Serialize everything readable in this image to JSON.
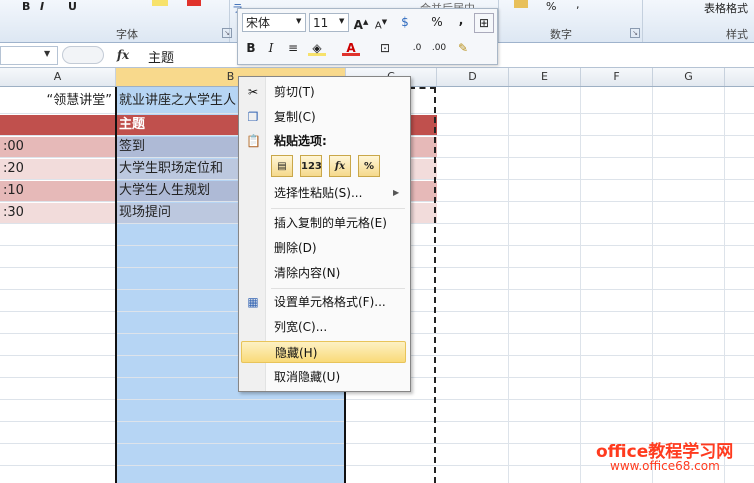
{
  "ribbon": {
    "font_group_label": "字体",
    "number_group_label": "数字",
    "styles_group_label": "样式",
    "table_format_label": "表格格式",
    "merge_center_label": "合并后居中",
    "percent_label": "%",
    "comma_label": ","
  },
  "formula_bar": {
    "fx_label": "fx",
    "content": "主题"
  },
  "columns": [
    "A",
    "B",
    "C",
    "D",
    "E",
    "F",
    "G"
  ],
  "sheet": {
    "title_row_a": "“领慧讲堂”",
    "title_row_b": "就业讲座之大学生人",
    "header_b": "主题",
    "rows": [
      {
        "a": ":00",
        "b": "签到"
      },
      {
        "a": ":20",
        "b": "大学生职场定位和"
      },
      {
        "a": ":10",
        "b": "大学生人生规划"
      },
      {
        "a": ":30",
        "b": "现场提问"
      }
    ]
  },
  "mini_toolbar": {
    "font_name": "宋体",
    "font_size": "11",
    "bold": "B",
    "italic": "I",
    "percent": "%",
    "comma": ","
  },
  "context_menu": {
    "cut": "剪切(T)",
    "copy": "复制(C)",
    "paste_options": "粘贴选项:",
    "paste_buttons": [
      "",
      "123",
      "fx",
      "%"
    ],
    "paste_special": "选择性粘贴(S)...",
    "insert_copied": "插入复制的单元格(E)",
    "delete": "删除(D)",
    "clear_contents": "清除内容(N)",
    "format_cells": "设置单元格格式(F)...",
    "column_width": "列宽(C)...",
    "hide": "隐藏(H)",
    "unhide": "取消隐藏(U)"
  },
  "watermark": {
    "line1": "office教程学习网",
    "line2": "www.office68.com"
  },
  "colors": {
    "header_red": "#c0504d",
    "row_pink_dark": "#e6b9b8",
    "row_pink_light": "#f2dcdb",
    "selection_blue": "#b6d5f4",
    "menu_highlight": "#f9da79"
  }
}
